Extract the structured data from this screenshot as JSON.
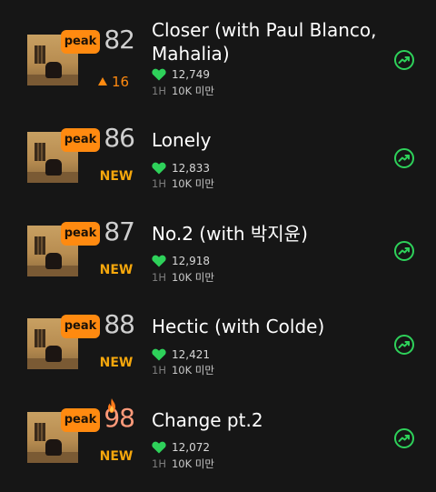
{
  "peak_label": "peak",
  "rows": [
    {
      "title": "Closer (with Paul Blanco, Mahalia)",
      "rank": "82",
      "change_type": "up",
      "change": "16",
      "likes": "12,749",
      "hour_label": "1H",
      "listeners": "10K 미만"
    },
    {
      "title": "Lonely",
      "rank": "86",
      "change_type": "new",
      "change": "NEW",
      "likes": "12,833",
      "hour_label": "1H",
      "listeners": "10K 미만"
    },
    {
      "title": "No.2 (with 박지윤)",
      "rank": "87",
      "change_type": "new",
      "change": "NEW",
      "likes": "12,918",
      "hour_label": "1H",
      "listeners": "10K 미만"
    },
    {
      "title": "Hectic (with Colde)",
      "rank": "88",
      "change_type": "new",
      "change": "NEW",
      "likes": "12,421",
      "hour_label": "1H",
      "listeners": "10K 미만"
    },
    {
      "title": "Change pt.2",
      "rank": "98",
      "change_type": "new",
      "change": "NEW",
      "likes": "12,072",
      "hour_label": "1H",
      "listeners": "10K 미만",
      "hot": true
    }
  ],
  "colors": {
    "accent": "#ff8a10",
    "like": "#2ed15a",
    "new": "#f5a70c",
    "trend": "#2ed15a",
    "background": "#161616"
  },
  "icons": {
    "like": "heart-icon",
    "trend": "trending-up-icon",
    "change": "arrow-up-icon",
    "hot": "flame-icon"
  }
}
